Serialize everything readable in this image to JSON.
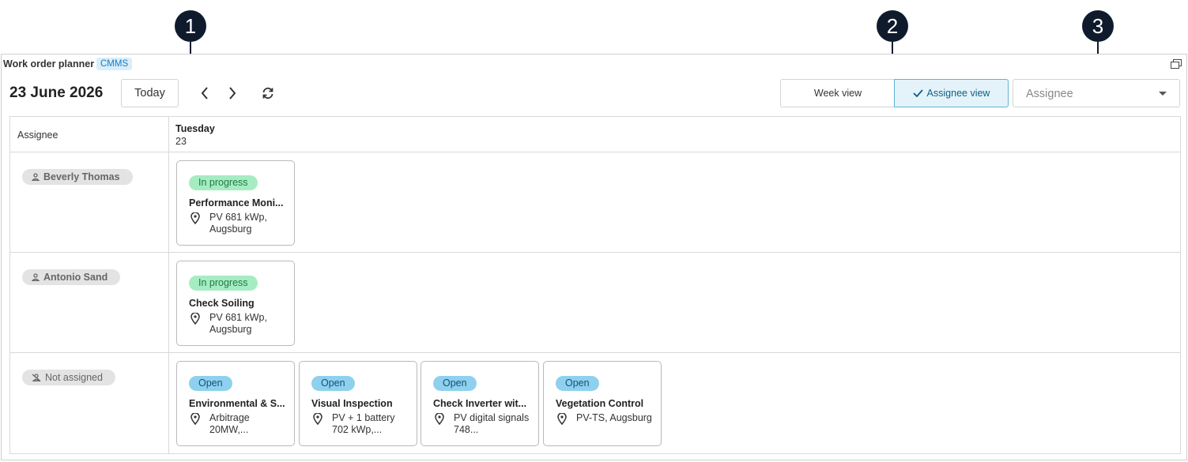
{
  "callouts": [
    "1",
    "2",
    "3"
  ],
  "widget": {
    "title": "Work order planner",
    "badge": "CMMS",
    "maximize_icon": "maximize-icon"
  },
  "toolbar": {
    "date": "23 June 2026",
    "today_label": "Today",
    "week_view_label": "Week view",
    "assignee_view_label": "Assignee view",
    "assignee_placeholder": "Assignee"
  },
  "grid": {
    "assignee_header": "Assignee",
    "day_name": "Tuesday",
    "day_number": "23",
    "rows": [
      {
        "assignee": "Beverly Thomas",
        "cards": [
          {
            "status": "In progress",
            "title": "Performance Moni...",
            "location": "PV 681 kWp, Augsburg"
          }
        ]
      },
      {
        "assignee": "Antonio Sand",
        "cards": [
          {
            "status": "In progress",
            "title": "Check Soiling",
            "location": "PV 681 kWp, Augsburg"
          }
        ]
      },
      {
        "assignee": "Not assigned",
        "cards": [
          {
            "status": "Open",
            "title": "Environmental & S...",
            "location": "Arbitrage 20MW,..."
          },
          {
            "status": "Open",
            "title": "Visual Inspection",
            "location": "PV + 1 battery 702 kWp,..."
          },
          {
            "status": "Open",
            "title": "Check Inverter wit...",
            "location": "PV digital signals 748..."
          },
          {
            "status": "Open",
            "title": "Vegetation Control",
            "location": "PV-TS, Augsburg"
          }
        ]
      }
    ]
  },
  "colors": {
    "accent": "#5fb3d8",
    "in_progress": "#a6ecc2",
    "open": "#8fd0ef",
    "callout": "#0f1b2d"
  }
}
